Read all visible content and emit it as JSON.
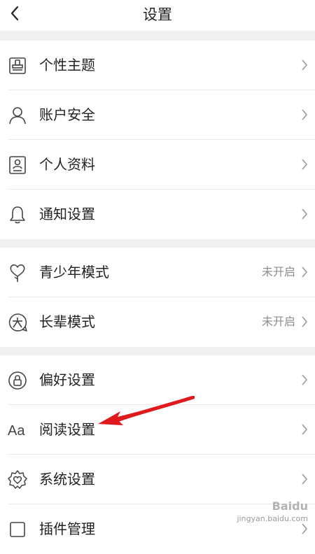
{
  "header": {
    "title": "设置"
  },
  "rows": [
    {
      "label": "个性主题",
      "status": "",
      "icon": "theme-brush-icon"
    },
    {
      "label": "账户安全",
      "status": "",
      "icon": "user-icon"
    },
    {
      "label": "个人资料",
      "status": "",
      "icon": "profile-card-icon"
    },
    {
      "label": "通知设置",
      "status": "",
      "icon": "bell-icon"
    },
    {
      "label": "青少年模式",
      "status": "未开启",
      "icon": "heart-tree-icon"
    },
    {
      "label": "长辈模式",
      "status": "未开启",
      "icon": "elder-icon"
    },
    {
      "label": "偏好设置",
      "status": "",
      "icon": "lock-circle-icon"
    },
    {
      "label": "阅读设置",
      "status": "",
      "icon": "font-aa-icon"
    },
    {
      "label": "系统设置",
      "status": "",
      "icon": "gear-heart-icon"
    },
    {
      "label": "插件管理",
      "status": "",
      "icon": "square-icon"
    }
  ],
  "annotation": {
    "color": "#e0191d",
    "points_to": "阅读设置"
  },
  "watermark": {
    "brand": "Baidu",
    "text": "jingyan.baidu.com"
  },
  "colors": {
    "text": "#222222",
    "secondary": "#8c8c8c",
    "separator": "#f1f1f1",
    "divider": "#e8e8e8"
  }
}
